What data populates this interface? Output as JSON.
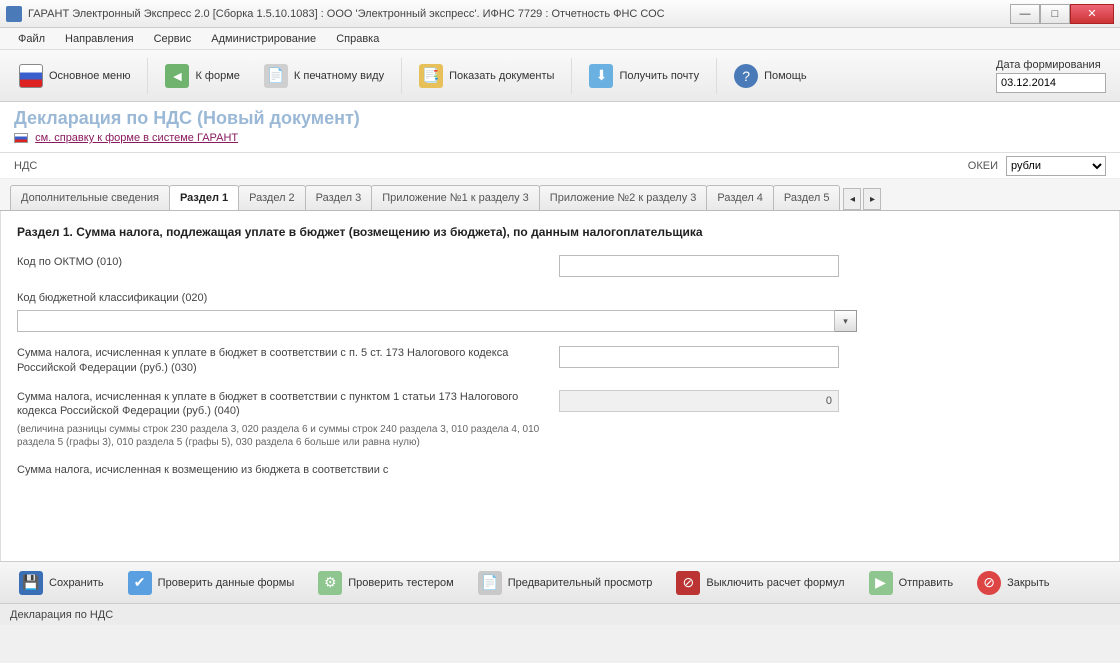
{
  "titlebar": "ГАРАНТ Электронный Экспресс 2.0 [Сборка 1.5.10.1083]  :  ООО 'Электронный экспресс'. ИФНС 7729  :  Отчетность ФНС СОС",
  "menu": {
    "file": "Файл",
    "nav": "Направления",
    "service": "Сервис",
    "admin": "Администрирование",
    "help": "Справка"
  },
  "toolbar": {
    "main": "Основное меню",
    "toform": "К форме",
    "toprint": "К печатному виду",
    "showdocs": "Показать документы",
    "getmail": "Получить почту",
    "help": "Помощь",
    "date_label": "Дата формирования",
    "date_value": "03.12.2014"
  },
  "doc": {
    "title": "Декларация по НДС (Новый документ)",
    "help_link": "см. справку к форме в системе ГАРАНТ"
  },
  "sub": {
    "nds": "НДС",
    "okei_label": "ОКЕИ",
    "okei_value": "рубли"
  },
  "tabs": {
    "t0": "Дополнительные сведения",
    "t1": "Раздел 1",
    "t2": "Раздел 2",
    "t3": "Раздел 3",
    "t4": "Приложение №1 к разделу 3",
    "t5": "Приложение №2 к разделу 3",
    "t6": "Раздел 4",
    "t7": "Раздел 5"
  },
  "section": {
    "title": "Раздел 1. Сумма налога, подлежащая уплате в бюджет (возмещению из бюджета), по данным налогоплательщика",
    "f010_label": "Код по ОКТМО (010)",
    "f020_label": "Код бюджетной классификации (020)",
    "f030_label": "Сумма налога, исчисленная к уплате в бюджет в соответствии с п. 5 ст. 173 Налогового кодекса Российской Федерации (руб.) (030)",
    "f040_label": "Сумма налога, исчисленная к уплате в бюджет в соответствии с пунктом 1 статьи 173 Налогового кодекса Российской Федерации (руб.) (040)",
    "f040_value": "0",
    "f040_note": "(величина разницы суммы строк 230 раздела 3, 020 раздела 6 и суммы строк 240 раздела 3, 010 раздела 4, 010 раздела 5 (графы 3), 010 раздела 5 (графы 5), 030 раздела 6 больше или равна нулю)",
    "f050_label": "Сумма налога, исчисленная к возмещению из бюджета в соответствии с"
  },
  "bottom": {
    "save": "Сохранить",
    "check": "Проверить данные формы",
    "test": "Проверить тестером",
    "preview": "Предварительный просмотр",
    "calcoff": "Выключить расчет формул",
    "send": "Отправить",
    "close": "Закрыть"
  },
  "status": "Декларация по НДС"
}
